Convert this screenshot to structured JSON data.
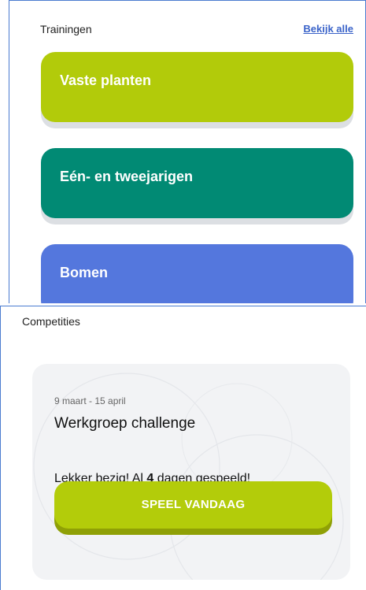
{
  "trainings": {
    "title": "Trainingen",
    "see_all": "Bekijk alle",
    "items": [
      {
        "label": "Vaste planten",
        "color": "#b2cb0a"
      },
      {
        "label": "Eén- en tweejarigen",
        "color": "#018a74"
      },
      {
        "label": "Bomen",
        "color": "#5477dd"
      }
    ]
  },
  "competitions": {
    "title": "Competities",
    "card": {
      "date_range": "9 maart - 15 april",
      "name": "Werkgroep challenge",
      "status_prefix": "Lekker bezig! Al ",
      "days": "4",
      "status_suffix": " dagen gespeeld!",
      "play_button": "SPEEL VANDAAG"
    }
  },
  "colors": {
    "accent_lime": "#b3cc0a",
    "accent_green": "#018a74",
    "accent_blue": "#5477dd",
    "link_blue": "#3a63c9"
  }
}
